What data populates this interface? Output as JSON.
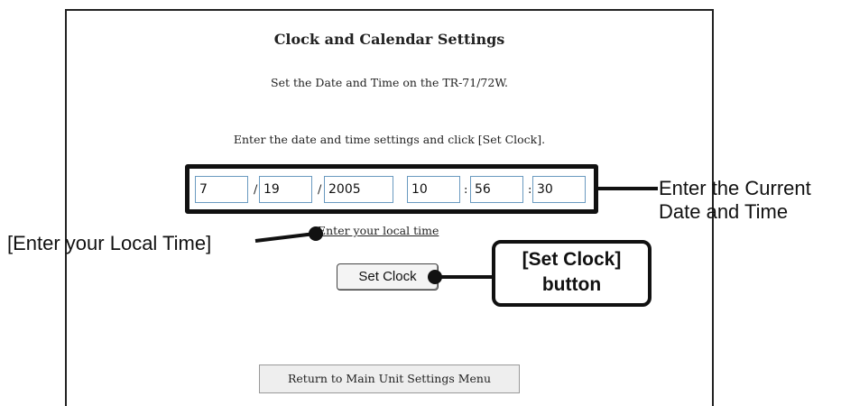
{
  "page": {
    "title": "Clock and Calendar Settings",
    "subtitle": "Set the Date and Time on the TR-71/72W.",
    "instruction": "Enter the date and time settings and click [Set Clock]."
  },
  "datetime": {
    "month": "7",
    "day": "19",
    "year": "2005",
    "hour": "10",
    "minute": "56",
    "second": "30",
    "date_separator": "/",
    "time_separator": ":"
  },
  "link": {
    "local_time": "Enter your local time"
  },
  "buttons": {
    "set_clock": "Set Clock",
    "return_menu": "Return to Main Unit Settings Menu"
  },
  "callouts": {
    "current_date_time_line1": "Enter the Current",
    "current_date_time_line2": "Date and Time",
    "local_time": "[Enter your Local Time]",
    "set_clock_line1": "[Set Clock]",
    "set_clock_line2": "button"
  },
  "colors": {
    "field_border": "#6a9ac0",
    "annotation": "#111111"
  }
}
